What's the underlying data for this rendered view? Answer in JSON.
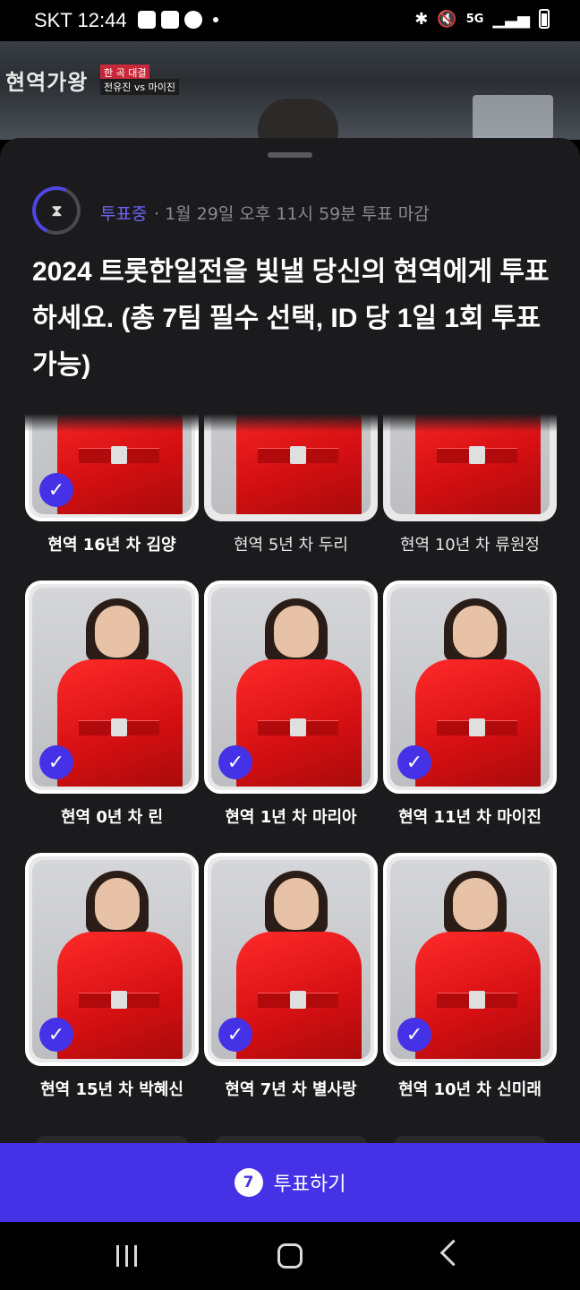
{
  "status_bar": {
    "carrier_time": "SKT 12:44",
    "network": "5G"
  },
  "video": {
    "logo": "현역가왕",
    "tag_top": "한 곡 대결",
    "tag_bottom": "전유진 vs 마이진"
  },
  "poll": {
    "status": "투표중",
    "deadline": "· 1월 29일 오후 11시 59분 투표 마감",
    "title": "2024 트롯한일전을 빛낼 당신의 현역에게 투표하세요. (총 7팀 필수 선택, ID 당 1일 1회 투표 가능)"
  },
  "candidates": [
    {
      "name": "현역 16년 차 김양",
      "selected": true
    },
    {
      "name": "현역 5년 차 두리",
      "selected": false
    },
    {
      "name": "현역 10년 차 류원정",
      "selected": false
    },
    {
      "name": "현역 0년 차 린",
      "selected": true
    },
    {
      "name": "현역 1년 차 마리아",
      "selected": true
    },
    {
      "name": "현역 11년 차 마이진",
      "selected": true
    },
    {
      "name": "현역 15년 차 박혜신",
      "selected": true
    },
    {
      "name": "현역 7년 차 별사랑",
      "selected": true
    },
    {
      "name": "현역 10년 차 신미래",
      "selected": true
    }
  ],
  "vote_button": {
    "count": "7",
    "label": "투표하기"
  },
  "icons": {
    "check": "check-icon",
    "timer": "hourglass-icon"
  },
  "colors": {
    "accent": "#4532e6",
    "status_text": "#6d64f5",
    "sheet_bg": "#1b1b1d"
  }
}
